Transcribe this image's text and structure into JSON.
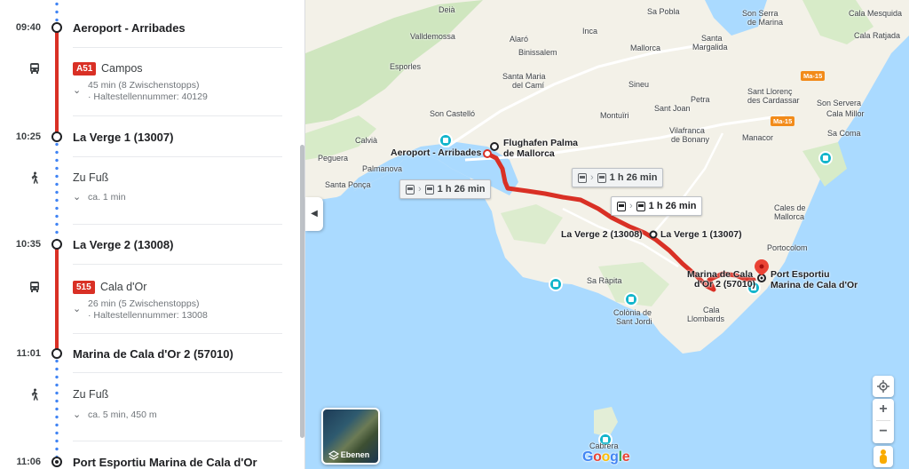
{
  "itinerary": {
    "steps": [
      {
        "time": "09:40",
        "stop": "Aeroport - Arribades"
      },
      {
        "transit": {
          "mode": "bus-icon",
          "line": "A51",
          "destination": "Campos",
          "duration": "45 min (8 Zwischenstopps)",
          "stop_id": "· Haltestellennummer: 40129"
        }
      },
      {
        "time": "10:25",
        "stop": "La Verge 1 (13007)"
      },
      {
        "walk": {
          "mode": "walk-icon",
          "label": "Zu Fuß",
          "detail": "ca. 1 min"
        }
      },
      {
        "time": "10:35",
        "stop": "La Verge 2 (13008)"
      },
      {
        "transit": {
          "mode": "bus-icon",
          "line": "515",
          "destination": "Cala d'Or",
          "duration": "26 min (5 Zwischenstopps)",
          "stop_id": "· Haltestellennummer: 13008"
        }
      },
      {
        "time": "11:01",
        "stop": "Marina de Cala d'Or 2 (57010)"
      },
      {
        "walk": {
          "mode": "walk-icon",
          "label": "Zu Fuß",
          "detail": "ca. 5 min, 450 m"
        }
      },
      {
        "time": "11:06",
        "stop": "Port Esportiu Marina de Cala d'Or"
      }
    ]
  },
  "map": {
    "route_boxes": [
      {
        "duration": "1 h 26 min"
      },
      {
        "duration": "1 h 26 min"
      },
      {
        "duration": "1 h 26 min"
      }
    ],
    "labels": {
      "airport_origin": "Aeroport - Arribades",
      "airport_name_1": "Flughafen Palma",
      "airport_name_2": "de Mallorca",
      "la_verge_2": "La Verge 2 (13008)",
      "la_verge_1": "La Verge 1 (13007)",
      "marina_1": "Marina de Cala",
      "marina_2": "d'Or 2 (57010)",
      "port_1": "Port Esportiu",
      "port_2": "Marina de Cala d'Or"
    },
    "towns": {
      "deia": "Deià",
      "valldemossa": "Valldemossa",
      "alaro": "Alaró",
      "inca": "Inca",
      "binissalem": "Binissalem",
      "mallorca": "Mallorca",
      "santa_margalida": "Santa",
      "santa_margalida_2": "Margalida",
      "sa_pobla": "Sa Pobla",
      "son_serra": "Son Serra",
      "de_marina": "de Marina",
      "cala_mesquida": "Cala Mesquida",
      "cala_ratjada": "Cala Ratjada",
      "esporles": "Esporles",
      "santa_maria": "Santa Maria",
      "del_cami": "del Camí",
      "son_castello": "Son Castelló",
      "sineu": "Sineu",
      "petra": "Petra",
      "montuiri": "Montuïri",
      "sant_joan": "Sant Joan",
      "sant_llorenc": "Sant Llorenç",
      "des_cardassar": "des Cardassar",
      "son_servera": "Son Servera",
      "cala_millor": "Cala Millor",
      "calvia": "Calvià",
      "vilafranca": "Vilafranca",
      "de_bonany": "de Bonany",
      "manacor": "Manacor",
      "sa_coma": "Sa Coma",
      "peguera": "Peguera",
      "palmanova": "Palmanova",
      "santa_ponca": "Santa Ponça",
      "cales_de": "Cales de",
      "mallorca_2": "Mallorca",
      "portocolom": "Portocolom",
      "sa_rapita": "Sa Ràpita",
      "colonia_de": "Colònia de",
      "sant_jordi": "Sant Jordi",
      "cala": "Cala",
      "llombards": "Llombards",
      "cabrera": "Cabrera"
    },
    "road_badges": [
      "Ma-15",
      "Ma-15"
    ],
    "layers_label": "Ebenen",
    "google_logo": "Google",
    "collapse_icon": "chevron-left-icon",
    "locate_icon": "my-location-icon"
  },
  "colors": {
    "route_red": "#d93025",
    "walk_blue": "#4285f4",
    "water": "#aadaff",
    "land": "#f5f3ea",
    "green": "#d4e8c7"
  }
}
